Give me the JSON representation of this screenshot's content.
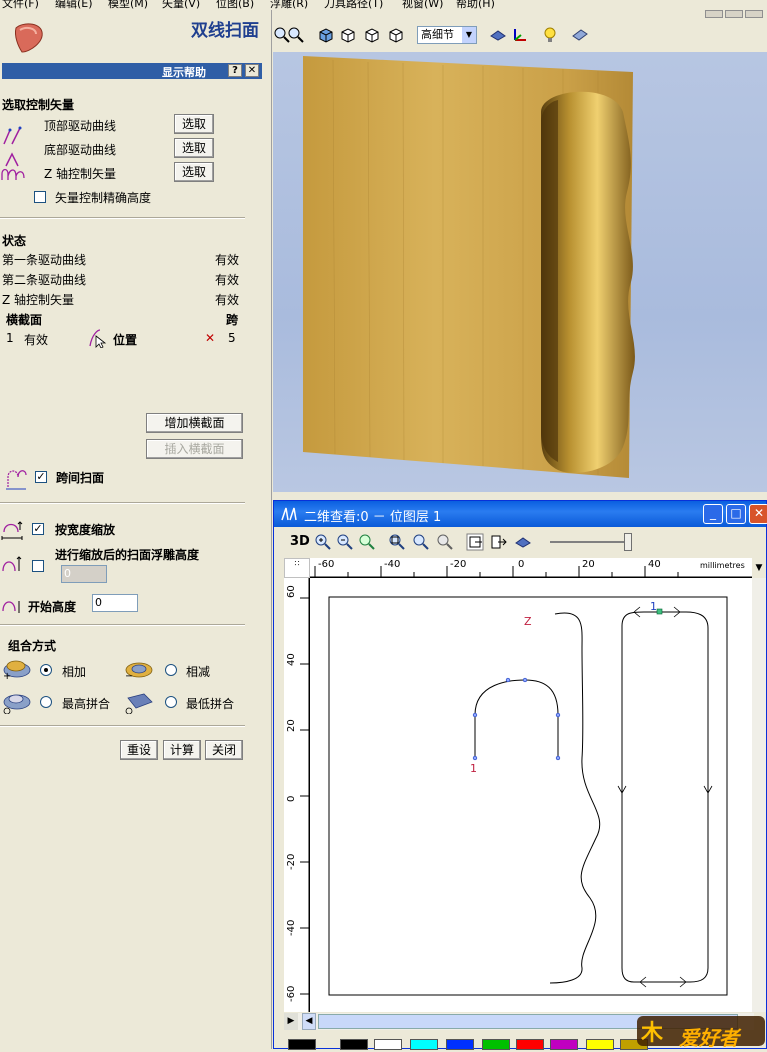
{
  "menubar": {
    "items": [
      "文件(F)",
      "编辑(E)",
      "模型(M)",
      "矢量(V)",
      "位图(B)",
      "浮雕(R)",
      "刀具路径(T)",
      "视窗(W)",
      "帮助(H)"
    ]
  },
  "panel": {
    "title": "双线扫面",
    "help_bar": {
      "label": "显示帮助",
      "help_btn": "?",
      "close_btn": "✕"
    },
    "select_section": {
      "title": "选取控制矢量",
      "rows": [
        {
          "label": "顶部驱动曲线",
          "button": "选取",
          "icon": "top-curve-icon"
        },
        {
          "label": "底部驱动曲线",
          "button": "选取",
          "icon": "bottom-curve-icon"
        },
        {
          "label": "Z 轴控制矢量",
          "button": "选取",
          "icon": "z-axis-icon"
        }
      ],
      "precise_height_label": "矢量控制精确高度"
    },
    "status_section": {
      "title": "状态",
      "rows": [
        {
          "label": "第一条驱动曲线",
          "value": "有效"
        },
        {
          "label": "第二条驱动曲线",
          "value": "有效"
        },
        {
          "label": "Z 轴控制矢量",
          "value": "有效"
        }
      ],
      "cross_header": "横截面",
      "span_header": "跨",
      "cross_row": {
        "index": "1",
        "state": "有效",
        "pos_label": "位置",
        "delete": "✕",
        "span": "5"
      }
    },
    "buttons": {
      "add_cross": "增加横截面",
      "insert_cross": "插入横截面"
    },
    "span_sweep_label": "跨间扫面",
    "scale_by_width_label": "按宽度缩放",
    "scaled_float_label": "进行缩放后的扫面浮雕高度",
    "scaled_float_value": "0",
    "start_height_label": "开始高度",
    "start_height_value": "0",
    "combine_section": {
      "title": "组合方式",
      "options": [
        "相加",
        "相减",
        "最高拼合",
        "最低拼合"
      ],
      "selected": "相加"
    },
    "actions": {
      "reset": "重设",
      "calculate": "计算",
      "close": "关闭"
    }
  },
  "view3d": {
    "detail_combo": "高细节"
  },
  "view2d": {
    "title": "二维查看:0 － 位图层 1",
    "toolbar_3d_label": "3D",
    "units": "millimetres",
    "h_ticks": [
      "-60",
      "-40",
      "-20",
      "0",
      "20",
      "40"
    ],
    "v_ticks": [
      "60",
      "40",
      "20",
      "0",
      "-20",
      "-40",
      "-60"
    ],
    "labels": {
      "z": "Z",
      "n1a": "1",
      "n1b": "1"
    }
  },
  "palette": {
    "colors": [
      "#000000",
      "#ffffff",
      "#00ffff",
      "#0000ff",
      "#00c000",
      "#ff0000",
      "#c000c0",
      "#ffff00",
      "#c0a000"
    ]
  },
  "logo": {
    "text": "爱好者"
  }
}
